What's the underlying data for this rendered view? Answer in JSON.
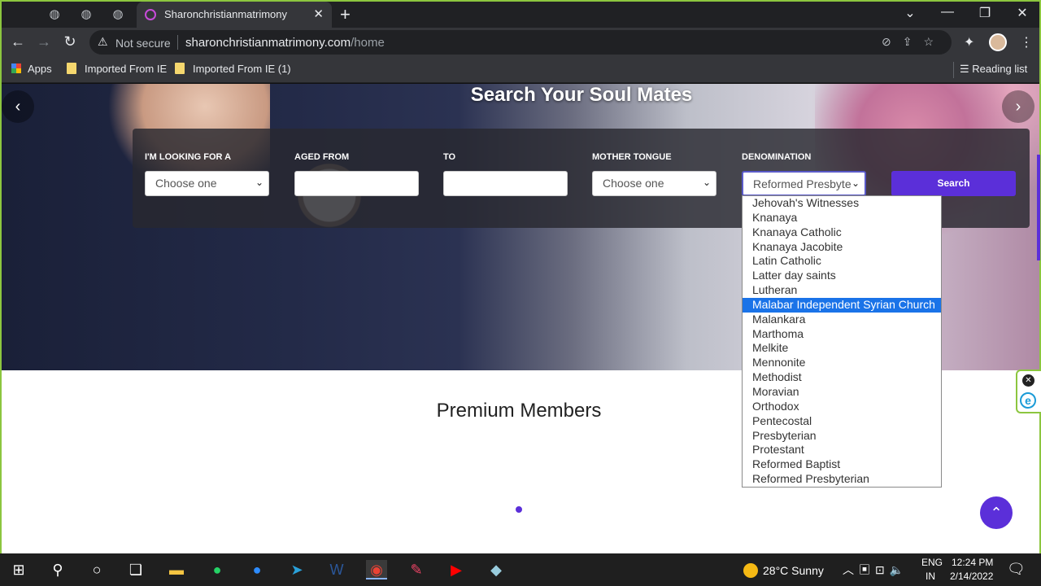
{
  "browser": {
    "tab_title": "Sharonchristianmatrimony",
    "security_label": "Not secure",
    "url_host": "sharonchristianmatrimony.com",
    "url_path": "/home",
    "bookmarks": [
      "Apps",
      "Imported From IE",
      "Imported From IE (1)"
    ],
    "reading_list": "Reading list"
  },
  "hero": {
    "title": "Search Your Soul Mates",
    "fields": {
      "looking_for": {
        "label": "I'M LOOKING FOR A",
        "value": "Choose one"
      },
      "aged_from": {
        "label": "AGED FROM",
        "value": ""
      },
      "to": {
        "label": "TO",
        "value": ""
      },
      "mother_tongue": {
        "label": "MOTHER TONGUE",
        "value": "Choose one"
      },
      "denomination": {
        "label": "DENOMINATION",
        "value": "Reformed Presbyte"
      }
    },
    "search_label": "Search"
  },
  "denomination_options": [
    "Jehovah's Witnesses",
    "Knanaya",
    "Knanaya Catholic",
    "Knanaya Jacobite",
    "Latin Catholic",
    "Latter day saints",
    "Lutheran",
    "Malabar Independent Syrian Church",
    "Malankara",
    "Marthoma",
    "Melkite",
    "Mennonite",
    "Methodist",
    "Moravian",
    "Orthodox",
    "Pentecostal",
    "Presbyterian",
    "Protestant",
    "Reformed Baptist",
    "Reformed Presbyterian"
  ],
  "highlighted_option": "Malabar Independent Syrian Church",
  "content": {
    "section_title": "Premium Members"
  },
  "taskbar": {
    "weather": "28°C  Sunny",
    "lang_top": "ENG",
    "lang_bottom": "IN",
    "time": "12:24 PM",
    "date": "2/14/2022"
  },
  "colors": {
    "accent": "#5b2fd9",
    "highlight": "#1a73e8",
    "frame": "#8cc63f"
  }
}
